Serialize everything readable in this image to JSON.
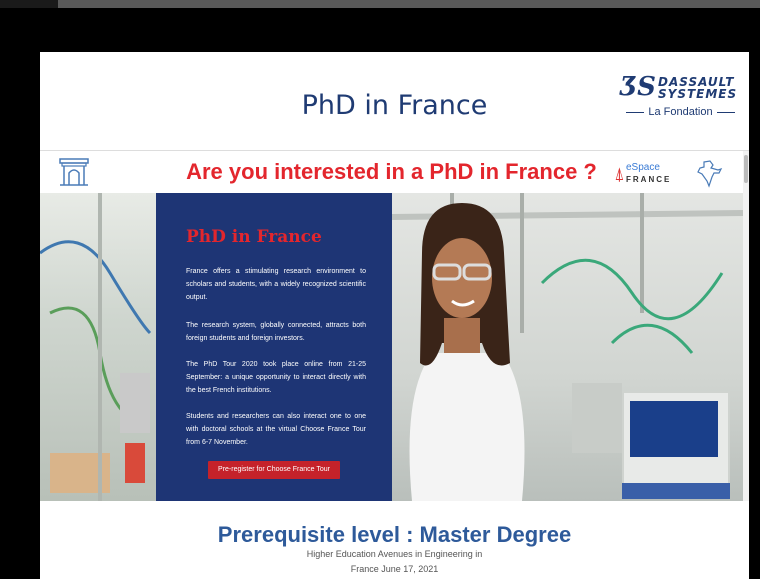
{
  "header": {
    "title": "PhD in France",
    "logo": {
      "mark": "ƷS",
      "line1": "DASSAULT",
      "line2": "SYSTEMES",
      "foundation": "La Fondation"
    }
  },
  "banner": {
    "question": "Are you interested in a PhD in France ?",
    "espace_line1": "eSpace",
    "espace_line2": "FRANCE"
  },
  "panel": {
    "title": "PhD in France",
    "p1": "France offers a stimulating research environment to scholars and students, with a widely recognized scientific output.",
    "p2": "The research system, globally connected, attracts both foreign students and foreign investors.",
    "p3": "The PhD Tour 2020 took place online from 21-25 September: a unique opportunity to interact directly with the best French institutions.",
    "p4": "Students and researchers can also interact one to one with doctoral schools at the virtual Choose France Tour from 6-7 November.",
    "button": "Pre-register for Choose France Tour"
  },
  "footer": {
    "subtitle": "Prerequisite level : Master Degree",
    "caption1": "Higher Education Avenues in Engineering in",
    "caption2": "France   June 17, 2021"
  },
  "colors": {
    "accent_red": "#e3262d",
    "navy": "#1e3575",
    "brand_blue": "#1f3b73"
  }
}
